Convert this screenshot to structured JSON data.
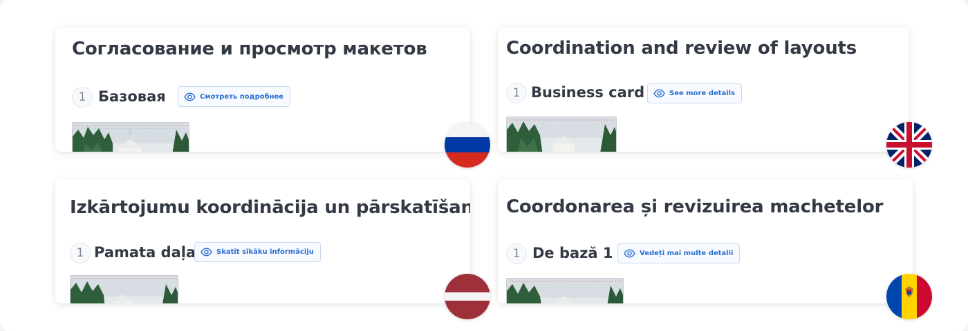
{
  "cards": [
    {
      "lang": "ru",
      "title": "Согласование и просмотр макетов",
      "step_number": "1",
      "step_label": "Базовая",
      "details_label": "Смотреть подробнее",
      "flag": "russia-flag"
    },
    {
      "lang": "en",
      "title": "Coordination and review of layouts",
      "step_number": "1",
      "step_label": "Business card",
      "details_label": "See more details",
      "flag": "uk-flag"
    },
    {
      "lang": "lv",
      "title": "Izkārtojumu koordinācija un pārskatīšana",
      "step_number": "1",
      "step_label": "Pamata daļa",
      "details_label": "Skatīt sīkāku informāciju",
      "flag": "latvia-flag"
    },
    {
      "lang": "ro",
      "title": "Coordonarea și revizuirea machetelor",
      "step_number": "1",
      "step_label": "De bază 1",
      "details_label": "Vedeți mai multe detalii",
      "flag": "moldova-flag"
    }
  ],
  "colors": {
    "accent": "#2a6ecf",
    "text": "#333a45",
    "russia": [
      "#ffffff",
      "#0039a6",
      "#d52b1e"
    ],
    "latvia": [
      "#9e3039",
      "#ffffff"
    ],
    "moldova": [
      "#0046ae",
      "#ffd200",
      "#cc092f"
    ],
    "uk": [
      "#012169",
      "#ffffff",
      "#c8102e"
    ]
  }
}
